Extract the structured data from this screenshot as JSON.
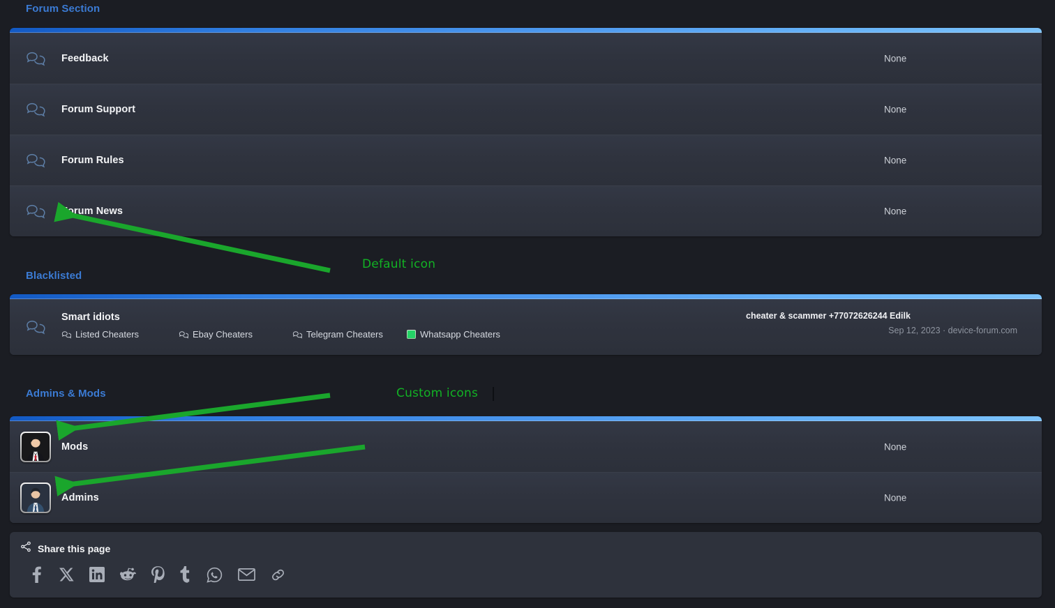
{
  "sections": [
    {
      "title": "Forum Section",
      "rows": [
        {
          "name": "Feedback",
          "icon": "speech-bubbles-icon",
          "status": "None"
        },
        {
          "name": "Forum Support",
          "icon": "speech-bubbles-icon",
          "status": "None"
        },
        {
          "name": "Forum Rules",
          "icon": "speech-bubbles-icon",
          "status": "None"
        },
        {
          "name": "Forum News",
          "icon": "speech-bubbles-icon",
          "status": "None"
        }
      ]
    },
    {
      "title": "Blacklisted",
      "rows": [
        {
          "name": "Smart idiots",
          "icon": "speech-bubbles-icon",
          "subforums": [
            {
              "label": "Listed Cheaters",
              "icon": "speech-bubble-small-icon"
            },
            {
              "label": "Ebay Cheaters",
              "icon": "speech-bubble-small-icon"
            },
            {
              "label": "Telegram Cheaters",
              "icon": "speech-bubble-small-icon"
            },
            {
              "label": "Whatsapp Cheaters",
              "icon": "whatsapp-custom-icon"
            }
          ],
          "last_thread": "cheater & scammer +77072626244 Edilk",
          "last_meta": "Sep 12, 2023 · device-forum.com"
        }
      ]
    },
    {
      "title": "Admins & Mods",
      "rows": [
        {
          "name": "Mods",
          "icon": "mods-avatar-icon",
          "status": "None"
        },
        {
          "name": "Admins",
          "icon": "admins-avatar-icon",
          "status": "None"
        }
      ]
    }
  ],
  "share": {
    "label": "Share this page",
    "head_icon": "share-nodes-icon",
    "icons": [
      "facebook-icon",
      "x-twitter-icon",
      "linkedin-icon",
      "reddit-icon",
      "pinterest-icon",
      "tumblr-icon",
      "whatsapp-icon",
      "email-icon",
      "link-icon"
    ]
  },
  "annotations": [
    {
      "label": "Default icon",
      "color": "#12b224"
    },
    {
      "label": "Custom icons",
      "color": "#12b224"
    }
  ],
  "colors": {
    "accent_blue": "#3b7bd4",
    "annotation_green": "#12b224",
    "panel_bg": "#2e323c",
    "page_bg": "#1b1d23"
  }
}
